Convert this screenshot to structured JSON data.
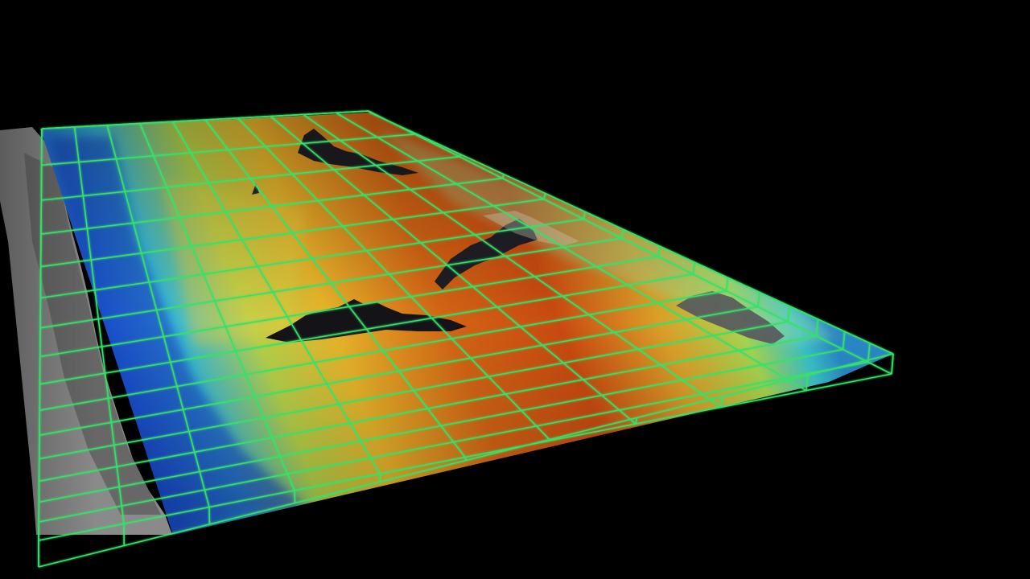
{
  "scene": {
    "subject": "3d-terrain-volume",
    "colors": {
      "background": "#000000",
      "grid": "#37e06a",
      "grid_bright": "#b8ff7a",
      "deep": "#1840c8",
      "shallow": "#2db8d8",
      "mid": "#e8d23a",
      "high": "#c8400e",
      "rock": "#1c1c20",
      "cliff": "#7a7a7a"
    }
  }
}
